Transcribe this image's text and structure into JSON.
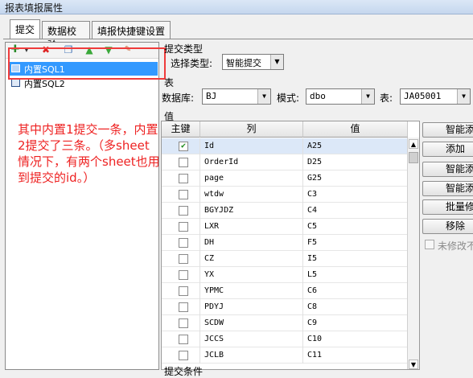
{
  "window": {
    "title": "报表填报属性"
  },
  "tabs": [
    {
      "label": "提交",
      "active": true
    },
    {
      "label": "数据校验"
    },
    {
      "label": "填报快捷键设置"
    }
  ],
  "toolbar": {
    "icons": [
      "add-icon",
      "delete-icon",
      "copy-icon",
      "move-up-icon",
      "move-down-icon",
      "sql-icon"
    ]
  },
  "tree": {
    "items": [
      {
        "label": "内置SQL1",
        "selected": true
      },
      {
        "label": "内置SQL2"
      }
    ]
  },
  "annotation": {
    "text": "其中内置1提交一条，内置2提交了三条。（多sheet情况下，有两个sheet也用到提交的id。）",
    "color": "#ee2222"
  },
  "submit_type": {
    "group_label": "提交类型",
    "select_label": "选择类型:",
    "value": "智能提交"
  },
  "table_group": {
    "group_label": "表",
    "database_label": "数据库:",
    "database_value": "BJ",
    "schema_label": "模式:",
    "schema_value": "dbo",
    "table_label": "表:",
    "table_value": "JA05001"
  },
  "value_group": {
    "group_label": "值"
  },
  "grid": {
    "headers": [
      "主键",
      "列",
      "值"
    ],
    "rows": [
      {
        "key": true,
        "col": "Id",
        "val": "A25"
      },
      {
        "key": false,
        "col": "OrderId",
        "val": "D25"
      },
      {
        "key": false,
        "col": "page",
        "val": "G25"
      },
      {
        "key": false,
        "col": "wtdw",
        "val": "C3"
      },
      {
        "key": false,
        "col": "BGYJDZ",
        "val": "C4"
      },
      {
        "key": false,
        "col": "LXR",
        "val": "C5"
      },
      {
        "key": false,
        "col": "DH",
        "val": "F5"
      },
      {
        "key": false,
        "col": "CZ",
        "val": "I5"
      },
      {
        "key": false,
        "col": "YX",
        "val": "L5"
      },
      {
        "key": false,
        "col": "YPMC",
        "val": "C6"
      },
      {
        "key": false,
        "col": "PDYJ",
        "val": "C8"
      },
      {
        "key": false,
        "col": "SCDW",
        "val": "C9"
      },
      {
        "key": false,
        "col": "JCCS",
        "val": "C10"
      },
      {
        "key": false,
        "col": "JCLB",
        "val": "C11"
      }
    ]
  },
  "side_buttons": [
    "智能添",
    "添加",
    "智能添",
    "智能添",
    "批量修",
    "移除"
  ],
  "no_change_label": "未修改不",
  "bottom_group": {
    "group_label": "提交条件"
  }
}
